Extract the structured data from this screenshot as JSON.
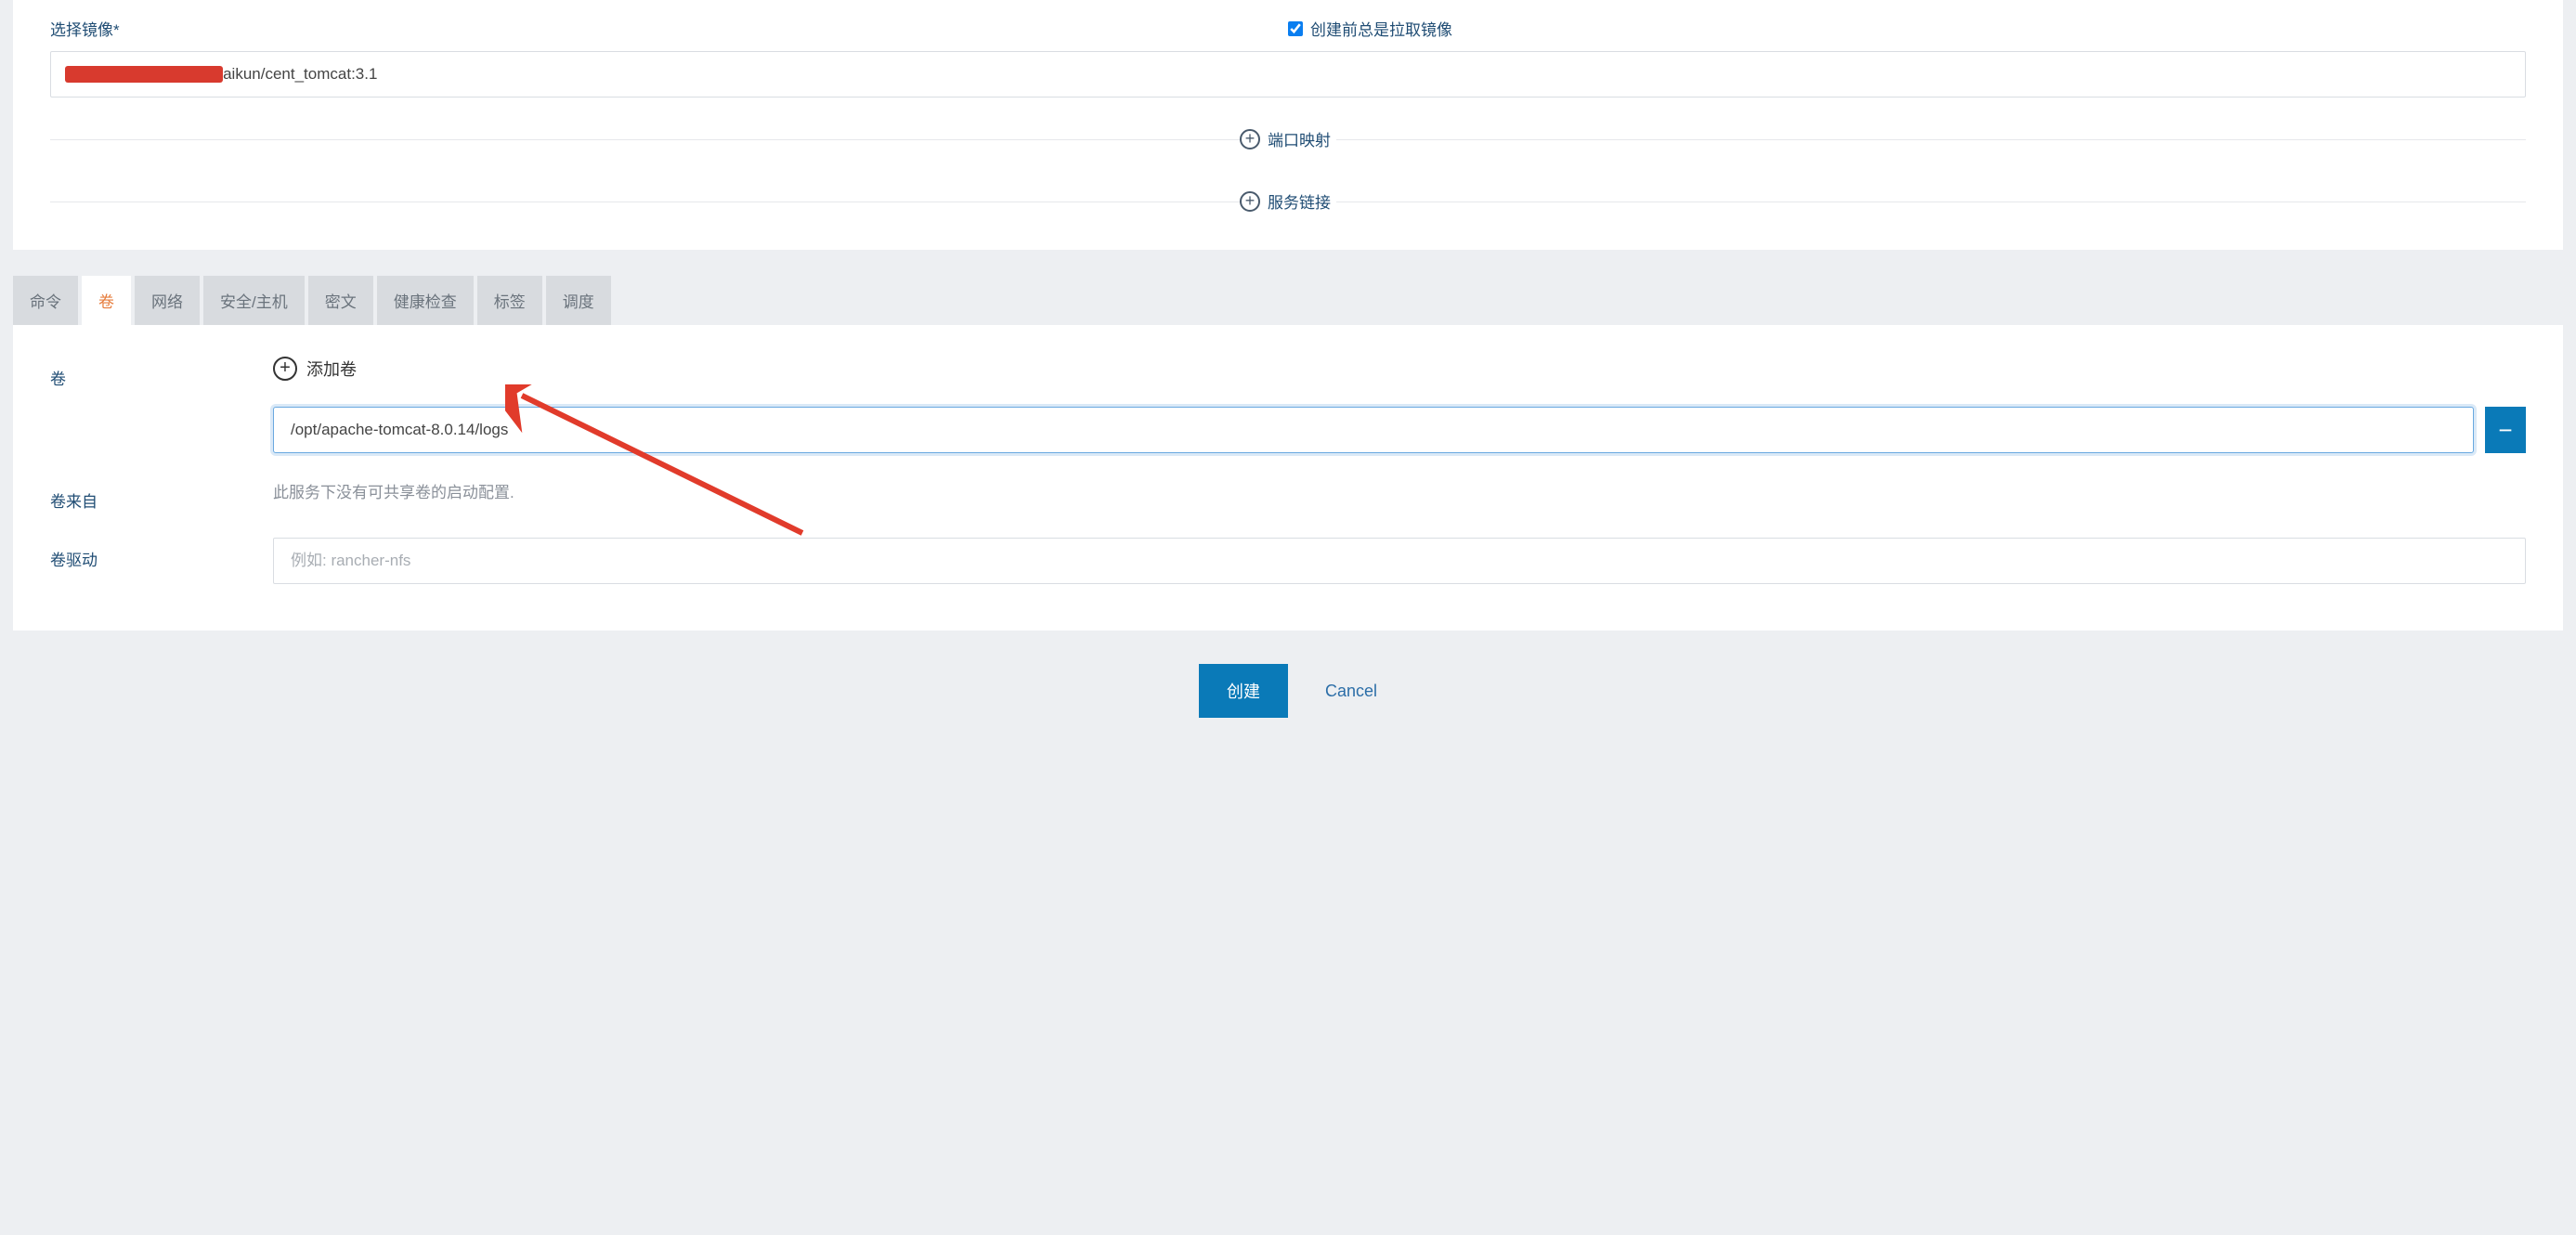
{
  "image_section": {
    "label": "选择镜像*",
    "pull_label": "创建前总是拉取镜像",
    "pull_checked": true,
    "image_value": "                               /zhaikun/cent_tomcat:3.1"
  },
  "expand": {
    "port_mapping": "端口映射",
    "service_link": "服务链接"
  },
  "tabs": {
    "items": [
      {
        "label": "命令",
        "active": false
      },
      {
        "label": "卷",
        "active": true
      },
      {
        "label": "网络",
        "active": false
      },
      {
        "label": "安全/主机",
        "active": false
      },
      {
        "label": "密文",
        "active": false
      },
      {
        "label": "健康检查",
        "active": false
      },
      {
        "label": "标签",
        "active": false
      },
      {
        "label": "调度",
        "active": false
      }
    ]
  },
  "volumes": {
    "label": "卷",
    "add_label": "添加卷",
    "entries": [
      {
        "value": "/opt/apache-tomcat-8.0.14/logs"
      }
    ],
    "from_label": "卷来自",
    "from_hint": "此服务下没有可共享卷的启动配置.",
    "driver_label": "卷驱动",
    "driver_placeholder": "例如: rancher-nfs"
  },
  "footer": {
    "create": "创建",
    "cancel": "Cancel"
  }
}
